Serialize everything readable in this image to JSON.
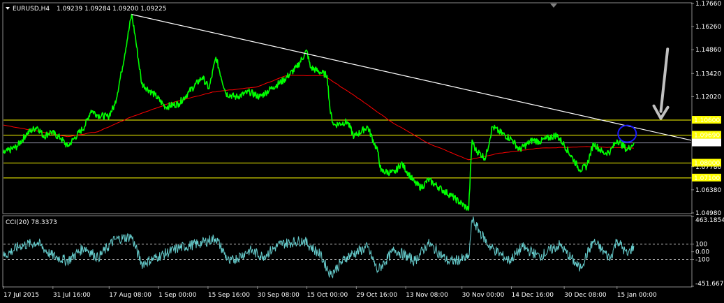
{
  "header": {
    "symbol": "EURUSD,H4",
    "ohlc": "1.09239 1.09284 1.09200 1.09225",
    "menu_icon": "triangle-down-icon"
  },
  "indicator": {
    "label": "CCI(20) 78.3373",
    "axis_labels": [
      "463.1854",
      "100",
      "0.00",
      "-100",
      "-451.6679"
    ]
  },
  "price_axis": {
    "labels": [
      "1.17660",
      "1.16260",
      "1.14860",
      "1.13420",
      "1.12020",
      "1.09690",
      "1.08000",
      "1.07780",
      "1.07100",
      "1.06380",
      "1.04980"
    ],
    "current_price_tag": "1.09225",
    "highlighted_levels": [
      "1.10600",
      "1.09690",
      "1.08000",
      "1.07100"
    ]
  },
  "time_axis": {
    "labels": [
      "17 Jul 2015",
      "31 Jul 16:00",
      "17 Aug 08:00",
      "1 Sep 00:00",
      "15 Sep 16:00",
      "30 Sep 08:00",
      "15 Oct 00:00",
      "29 Oct 16:00",
      "13 Nov 08:00",
      "30 Nov 00:00",
      "14 Dec 16:00",
      "30 Dec 08:00",
      "15 Jan 00:00"
    ]
  },
  "colors": {
    "price_line": "#00ff00",
    "moving_average": "#ff0000",
    "trendline": "#ffffff",
    "support_resistance": "#ffff00",
    "cci_line": "#66cccc",
    "circle_marker": "#1a1aff",
    "arrow": "#c0c0c0"
  },
  "chart_data": {
    "type": "line",
    "price_series": [
      {
        "t": "2015-07-17",
        "v": 1.086
      },
      {
        "t": "2015-07-21",
        "v": 1.09
      },
      {
        "t": "2015-07-24",
        "v": 1.098
      },
      {
        "t": "2015-07-27",
        "v": 1.102
      },
      {
        "t": "2015-07-29",
        "v": 1.096
      },
      {
        "t": "2015-07-31",
        "v": 1.099
      },
      {
        "t": "2015-08-03",
        "v": 1.095
      },
      {
        "t": "2015-08-05",
        "v": 1.09
      },
      {
        "t": "2015-08-07",
        "v": 1.095
      },
      {
        "t": "2015-08-10",
        "v": 1.102
      },
      {
        "t": "2015-08-12",
        "v": 1.112
      },
      {
        "t": "2015-08-14",
        "v": 1.109
      },
      {
        "t": "2015-08-17",
        "v": 1.108
      },
      {
        "t": "2015-08-19",
        "v": 1.115
      },
      {
        "t": "2015-08-21",
        "v": 1.135
      },
      {
        "t": "2015-08-24",
        "v": 1.17
      },
      {
        "t": "2015-08-25",
        "v": 1.158
      },
      {
        "t": "2015-08-27",
        "v": 1.128
      },
      {
        "t": "2015-08-31",
        "v": 1.121
      },
      {
        "t": "2015-09-03",
        "v": 1.114
      },
      {
        "t": "2015-09-07",
        "v": 1.116
      },
      {
        "t": "2015-09-10",
        "v": 1.123
      },
      {
        "t": "2015-09-14",
        "v": 1.132
      },
      {
        "t": "2015-09-16",
        "v": 1.125
      },
      {
        "t": "2015-09-18",
        "v": 1.144
      },
      {
        "t": "2015-09-21",
        "v": 1.122
      },
      {
        "t": "2015-09-24",
        "v": 1.12
      },
      {
        "t": "2015-09-28",
        "v": 1.123
      },
      {
        "t": "2015-10-01",
        "v": 1.12
      },
      {
        "t": "2015-10-05",
        "v": 1.126
      },
      {
        "t": "2015-10-08",
        "v": 1.13
      },
      {
        "t": "2015-10-12",
        "v": 1.138
      },
      {
        "t": "2015-10-15",
        "v": 1.148
      },
      {
        "t": "2015-10-16",
        "v": 1.138
      },
      {
        "t": "2015-10-19",
        "v": 1.135
      },
      {
        "t": "2015-10-21",
        "v": 1.133
      },
      {
        "t": "2015-10-22",
        "v": 1.11
      },
      {
        "t": "2015-10-23",
        "v": 1.103
      },
      {
        "t": "2015-10-27",
        "v": 1.105
      },
      {
        "t": "2015-10-29",
        "v": 1.096
      },
      {
        "t": "2015-11-02",
        "v": 1.102
      },
      {
        "t": "2015-11-05",
        "v": 1.087
      },
      {
        "t": "2015-11-06",
        "v": 1.075
      },
      {
        "t": "2015-11-10",
        "v": 1.074
      },
      {
        "t": "2015-11-12",
        "v": 1.08
      },
      {
        "t": "2015-11-16",
        "v": 1.068
      },
      {
        "t": "2015-11-18",
        "v": 1.065
      },
      {
        "t": "2015-11-20",
        "v": 1.07
      },
      {
        "t": "2015-11-24",
        "v": 1.064
      },
      {
        "t": "2015-11-27",
        "v": 1.06
      },
      {
        "t": "2015-12-02",
        "v": 1.052
      },
      {
        "t": "2015-12-03",
        "v": 1.094
      },
      {
        "t": "2015-12-04",
        "v": 1.088
      },
      {
        "t": "2015-12-07",
        "v": 1.083
      },
      {
        "t": "2015-12-09",
        "v": 1.102
      },
      {
        "t": "2015-12-11",
        "v": 1.099
      },
      {
        "t": "2015-12-15",
        "v": 1.094
      },
      {
        "t": "2015-12-17",
        "v": 1.088
      },
      {
        "t": "2015-12-21",
        "v": 1.094
      },
      {
        "t": "2015-12-23",
        "v": 1.093
      },
      {
        "t": "2015-12-28",
        "v": 1.097
      },
      {
        "t": "2015-12-30",
        "v": 1.092
      },
      {
        "t": "2016-01-04",
        "v": 1.076
      },
      {
        "t": "2016-01-06",
        "v": 1.078
      },
      {
        "t": "2016-01-08",
        "v": 1.092
      },
      {
        "t": "2016-01-11",
        "v": 1.086
      },
      {
        "t": "2016-01-13",
        "v": 1.087
      },
      {
        "t": "2016-01-15",
        "v": 1.094
      },
      {
        "t": "2016-01-18",
        "v": 1.088
      },
      {
        "t": "2016-01-20",
        "v": 1.0922
      }
    ],
    "moving_average": [
      {
        "t": "2015-07-17",
        "v": 1.103
      },
      {
        "t": "2015-07-28",
        "v": 1.099
      },
      {
        "t": "2015-08-05",
        "v": 1.096
      },
      {
        "t": "2015-08-14",
        "v": 1.099
      },
      {
        "t": "2015-08-24",
        "v": 1.108
      },
      {
        "t": "2015-09-04",
        "v": 1.116
      },
      {
        "t": "2015-09-17",
        "v": 1.123
      },
      {
        "t": "2015-09-30",
        "v": 1.126
      },
      {
        "t": "2015-10-09",
        "v": 1.133
      },
      {
        "t": "2015-10-20",
        "v": 1.133
      },
      {
        "t": "2015-10-29",
        "v": 1.121
      },
      {
        "t": "2015-11-09",
        "v": 1.105
      },
      {
        "t": "2015-11-20",
        "v": 1.092
      },
      {
        "t": "2015-12-02",
        "v": 1.082
      },
      {
        "t": "2015-12-11",
        "v": 1.086
      },
      {
        "t": "2015-12-23",
        "v": 1.089
      },
      {
        "t": "2016-01-06",
        "v": 1.09
      },
      {
        "t": "2016-01-20",
        "v": 1.089
      }
    ],
    "trendline": {
      "from": {
        "t": "2015-08-24",
        "v": 1.17
      },
      "to": {
        "t": "2016-02-06",
        "v": 1.0938
      }
    },
    "horizontal_levels": [
      1.106,
      1.0969,
      1.0922,
      1.08,
      1.071
    ],
    "circle_marker": {
      "t": "2016-01-18",
      "v": 1.0969
    },
    "arrow": {
      "from": {
        "t": "2016-01-30",
        "v": 1.149
      },
      "to": {
        "t": "2016-01-28",
        "v": 1.107
      }
    },
    "cci_series": [
      {
        "t": "2015-07-17",
        "v": -60
      },
      {
        "t": "2015-07-22",
        "v": 80
      },
      {
        "t": "2015-07-27",
        "v": 120
      },
      {
        "t": "2015-07-31",
        "v": -40
      },
      {
        "t": "2015-08-05",
        "v": -120
      },
      {
        "t": "2015-08-10",
        "v": 60
      },
      {
        "t": "2015-08-14",
        "v": -80
      },
      {
        "t": "2015-08-19",
        "v": 160
      },
      {
        "t": "2015-08-24",
        "v": 200
      },
      {
        "t": "2015-08-27",
        "v": -160
      },
      {
        "t": "2015-09-01",
        "v": -60
      },
      {
        "t": "2015-09-07",
        "v": 50
      },
      {
        "t": "2015-09-14",
        "v": 120
      },
      {
        "t": "2015-09-18",
        "v": 180
      },
      {
        "t": "2015-09-22",
        "v": -140
      },
      {
        "t": "2015-09-28",
        "v": 20
      },
      {
        "t": "2015-10-02",
        "v": -60
      },
      {
        "t": "2015-10-07",
        "v": 100
      },
      {
        "t": "2015-10-14",
        "v": 150
      },
      {
        "t": "2015-10-19",
        "v": -40
      },
      {
        "t": "2015-10-22",
        "v": -300
      },
      {
        "t": "2015-10-27",
        "v": -60
      },
      {
        "t": "2015-11-02",
        "v": 60
      },
      {
        "t": "2015-11-05",
        "v": -250
      },
      {
        "t": "2015-11-10",
        "v": 30
      },
      {
        "t": "2015-11-16",
        "v": -120
      },
      {
        "t": "2015-11-20",
        "v": 110
      },
      {
        "t": "2015-11-26",
        "v": -130
      },
      {
        "t": "2015-12-02",
        "v": -80
      },
      {
        "t": "2015-12-03",
        "v": 420
      },
      {
        "t": "2015-12-08",
        "v": 80
      },
      {
        "t": "2015-12-14",
        "v": -120
      },
      {
        "t": "2015-12-18",
        "v": 60
      },
      {
        "t": "2015-12-23",
        "v": -60
      },
      {
        "t": "2015-12-29",
        "v": 90
      },
      {
        "t": "2016-01-04",
        "v": -220
      },
      {
        "t": "2016-01-08",
        "v": 140
      },
      {
        "t": "2016-01-13",
        "v": -90
      },
      {
        "t": "2016-01-15",
        "v": 160
      },
      {
        "t": "2016-01-18",
        "v": -40
      },
      {
        "t": "2016-01-20",
        "v": 78
      }
    ],
    "price_ylim": [
      1.0498,
      1.1766
    ],
    "cci_ylim": [
      -451.6679,
      463.1854
    ],
    "xlim": [
      "2015-07-17",
      "2016-02-06"
    ]
  }
}
